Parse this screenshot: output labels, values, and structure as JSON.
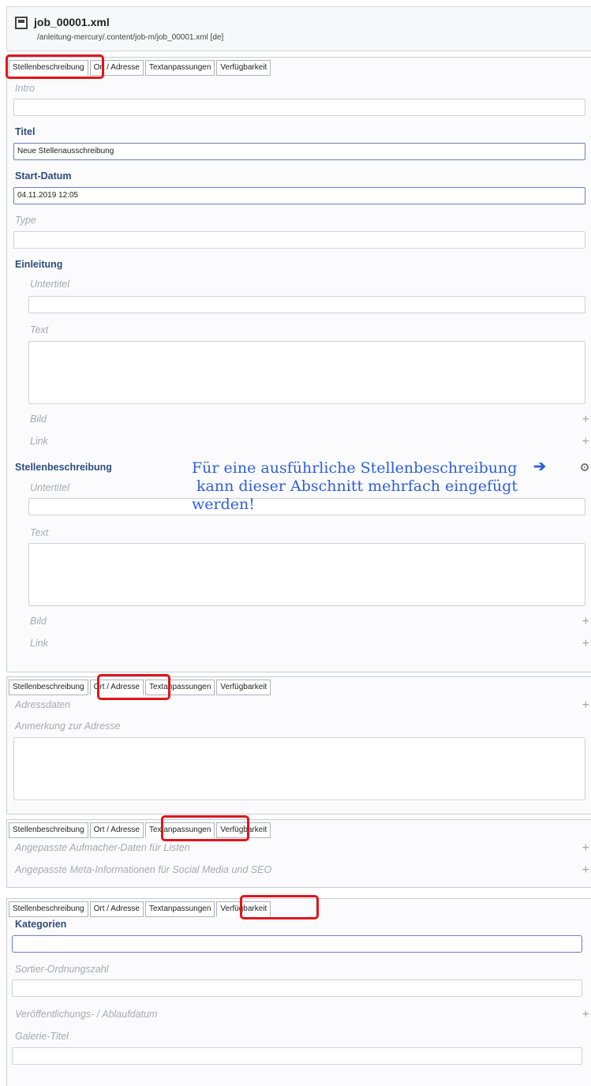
{
  "header": {
    "file_name": "job_00001.xml",
    "file_path": "/anleitung-mercury/.content/job-m/job_00001.xml [de]"
  },
  "tabs": [
    "Stellenbeschreibung",
    "Ort / Adresse",
    "Textanpassungen",
    "Verfügbarkeit"
  ],
  "panel1": {
    "intro_label": "Intro",
    "titel_label": "Titel",
    "titel_value": "Neue Stellenausschreibung",
    "start_label": "Start-Datum",
    "start_value": "04.11.2019 12:05",
    "type_label": "Type",
    "einleitung_label": "Einleitung",
    "untertitel_label": "Untertitel",
    "text_label": "Text",
    "bild_label": "Bild",
    "link_label": "Link",
    "stellenbeschreibung_label": "Stellenbeschreibung"
  },
  "annotation": {
    "line1": "Für eine ausführliche Stellenbeschreibung",
    "line2": " kann dieser Abschnitt mehrfach eingefügt",
    "line3": "werden!"
  },
  "panel2": {
    "adressdaten_label": "Adressdaten",
    "anmerkung_label": "Anmerkung zur Adresse"
  },
  "panel3": {
    "aufmacher_label": "Angepasste Aufmacher-Daten für Listen",
    "meta_label": "Angepasste Meta-Informationen für Social Media und SEO"
  },
  "panel4": {
    "kategorien_label": "Kategorien",
    "sortier_label": "Sortier-Ordnungszahl",
    "veroeff_label": "Veröffentlichungs- / Ablaufdatum",
    "galerie_label": "Galerie-Titel"
  },
  "icons": {
    "file": "file-icon",
    "add": "plus-icon",
    "arrow": "arrow-right-icon",
    "target": "target-icon"
  },
  "colors": {
    "highlight": "#e0151b",
    "annotation": "#2f5fd8",
    "label_bold": "#2e4d7a"
  }
}
